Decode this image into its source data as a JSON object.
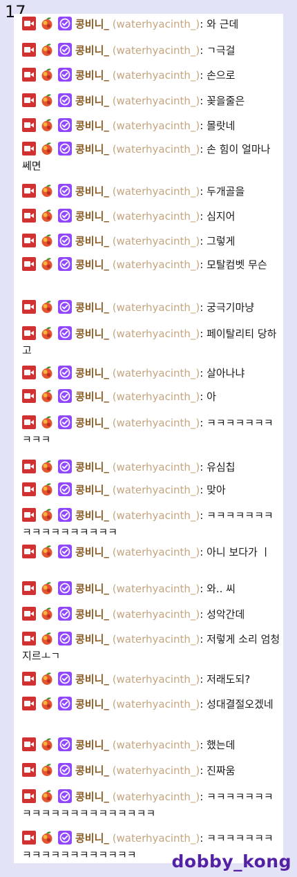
{
  "page_number": "17",
  "watermark": "dobby_kong",
  "badges": [
    "camera-badge-icon",
    "fruit-badge-icon",
    "verified-badge-icon"
  ],
  "colors": {
    "background": "#e3e3f7",
    "panel": "#ffffff",
    "display_name": "#8a5a21",
    "login_name": "#c4a47e",
    "camera_badge": "#d13131",
    "verified_badge": "#9146ff",
    "watermark": "#5521a4"
  },
  "messages": [
    {
      "name": "콩비니_",
      "login": "(waterhyacinth_)",
      "text": "와 근데"
    },
    {
      "name": "콩비니_",
      "login": "(waterhyacinth_)",
      "text": "ㄱ극걸"
    },
    {
      "name": "콩비니_",
      "login": "(waterhyacinth_)",
      "text": "손으로"
    },
    {
      "name": "콩비니_",
      "login": "(waterhyacinth_)",
      "text": "꽂을줄은"
    },
    {
      "name": "콩비니_",
      "login": "(waterhyacinth_)",
      "text": "몰랏네"
    },
    {
      "name": "콩비니_",
      "login": "(waterhyacinth_)",
      "text": "손 힘이 얼마나 쎄면"
    },
    {
      "name": "콩비니_",
      "login": "(waterhyacinth_)",
      "text": "두개골을"
    },
    {
      "name": "콩비니_",
      "login": "(waterhyacinth_)",
      "text": "심지어"
    },
    {
      "name": "콩비니_",
      "login": "(waterhyacinth_)",
      "text": "그렇게"
    },
    {
      "name": "콩비니_",
      "login": "(waterhyacinth_)",
      "text": "모탈컴벳 무슨"
    },
    {
      "name": "콩비니_",
      "login": "(waterhyacinth_)",
      "text": "궁극기마냥"
    },
    {
      "name": "콩비니_",
      "login": "(waterhyacinth_)",
      "text": "페이탈리티 당하고"
    },
    {
      "name": "콩비니_",
      "login": "(waterhyacinth_)",
      "text": "살아나냐"
    },
    {
      "name": "콩비니_",
      "login": "(waterhyacinth_)",
      "text": "아"
    },
    {
      "name": "콩비니_",
      "login": "(waterhyacinth_)",
      "text": "ㅋㅋㅋㅋㅋㅋㅋㅋㅋㅋ"
    },
    {
      "name": "콩비니_",
      "login": "(waterhyacinth_)",
      "text": "유심칩"
    },
    {
      "name": "콩비니_",
      "login": "(waterhyacinth_)",
      "text": "맞아"
    },
    {
      "name": "콩비니_",
      "login": "(waterhyacinth_)",
      "text": "ㅋㅋㅋㅋㅋㅋㅋㅋㅋㅋㅋㅋㅋㅋㅋㅋㅋ"
    },
    {
      "name": "콩비니_",
      "login": "(waterhyacinth_)",
      "text": "아니 보다가 ㅣ"
    },
    {
      "name": "콩비니_",
      "login": "(waterhyacinth_)",
      "text": "와.. 씨"
    },
    {
      "name": "콩비니_",
      "login": "(waterhyacinth_)",
      "text": "성악간데"
    },
    {
      "name": "콩비니_",
      "login": "(waterhyacinth_)",
      "text": "저렇게 소리 엄청지르ㅗㄱ"
    },
    {
      "name": "콩비니_",
      "login": "(waterhyacinth_)",
      "text": "저래도되?"
    },
    {
      "name": "콩비니_",
      "login": "(waterhyacinth_)",
      "text": "성대결절오겠네"
    },
    {
      "name": "콩비니_",
      "login": "(waterhyacinth_)",
      "text": "했는데"
    },
    {
      "name": "콩비니_",
      "login": "(waterhyacinth_)",
      "text": "진짜움"
    },
    {
      "name": "콩비니_",
      "login": "(waterhyacinth_)",
      "text": "ㅋㅋㅋㅋㅋㅋㅋㅋㅋㅋㅋㅋㅋㅋㅋㅋㅋㅋㅋㅋㅋ"
    },
    {
      "name": "콩비니_",
      "login": "(waterhyacinth_)",
      "text": "ㅋㅋㅋㅋㅋㅋㅋㅋㅋㅋㅋㅋㅋㅋㅋㅋㅋㅋㅋ"
    }
  ]
}
